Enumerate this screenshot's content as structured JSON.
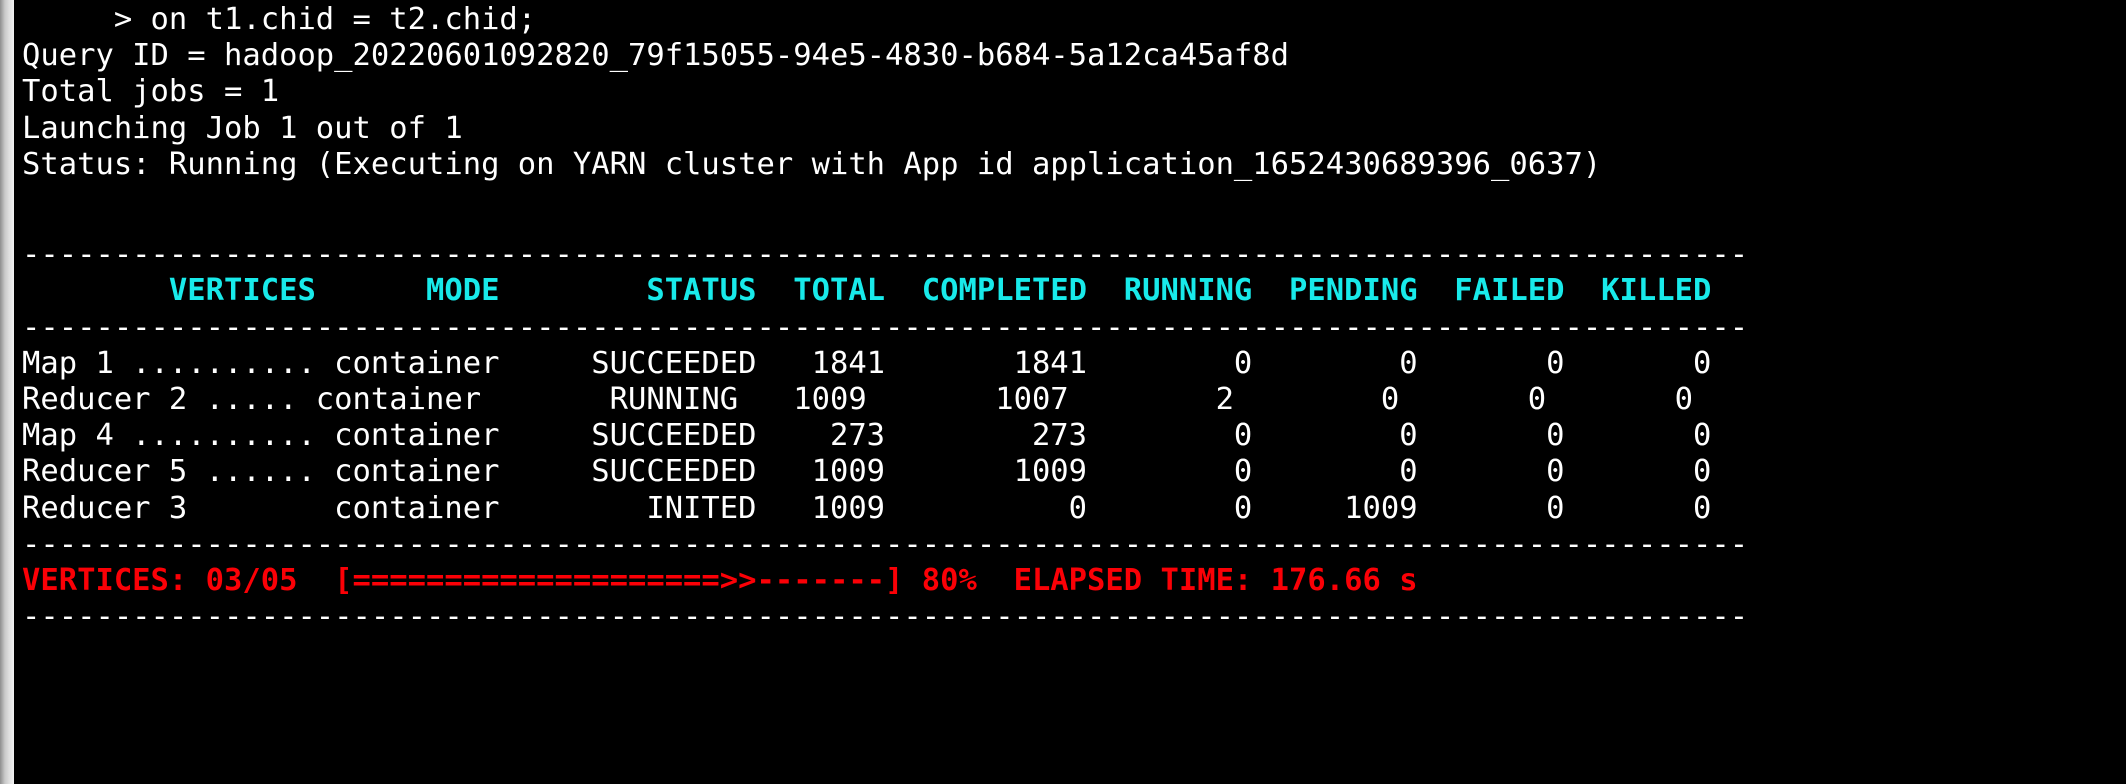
{
  "terminal": {
    "background_color": "#000000",
    "foreground_color": "#ffffff",
    "header_color": "#18eaea",
    "progress_color": "#fb0006",
    "preamble": [
      "     > on t1.chid = t2.chid;",
      "Query ID = hadoop_20220601092820_79f15055-94e5-4830-b684-5a12ca45af8d",
      "Total jobs = 1",
      "Launching Job 1 out of 1",
      "Status: Running (Executing on YARN cluster with App id application_1652430689396_0637)"
    ],
    "separator": "----------------------------------------------------------------------------------------------",
    "table": {
      "header": "        VERTICES      MODE        STATUS  TOTAL  COMPLETED  RUNNING  PENDING  FAILED  KILLED",
      "columns": [
        "VERTICES",
        "MODE",
        "STATUS",
        "TOTAL",
        "COMPLETED",
        "RUNNING",
        "PENDING",
        "FAILED",
        "KILLED"
      ],
      "rows": [
        {
          "line": "Map 1 .......... container     SUCCEEDED   1841       1841        0        0       0       0",
          "vertex": "Map 1 ..........",
          "mode": "container",
          "status": "SUCCEEDED",
          "total": "1841",
          "completed": "1841",
          "running": "0",
          "pending": "0",
          "failed": "0",
          "killed": "0"
        },
        {
          "line": "Reducer 2 ..... container       RUNNING   1009       1007        2        0       0       0",
          "vertex": "Reducer 2 .....",
          "mode": "container",
          "status": "RUNNING",
          "total": "1009",
          "completed": "1007",
          "running": "2",
          "pending": "0",
          "failed": "0",
          "killed": "0"
        },
        {
          "line": "Map 4 .......... container     SUCCEEDED    273        273        0        0       0       0",
          "vertex": "Map 4 ..........",
          "mode": "container",
          "status": "SUCCEEDED",
          "total": "273",
          "completed": "273",
          "running": "0",
          "pending": "0",
          "failed": "0",
          "killed": "0"
        },
        {
          "line": "Reducer 5 ...... container     SUCCEEDED   1009       1009        0        0       0       0",
          "vertex": "Reducer 5 ......",
          "mode": "container",
          "status": "SUCCEEDED",
          "total": "1009",
          "completed": "1009",
          "running": "0",
          "pending": "0",
          "failed": "0",
          "killed": "0"
        },
        {
          "line": "Reducer 3        container        INITED   1009          0        0     1009       0       0",
          "vertex": "Reducer 3",
          "mode": "container",
          "status": "INITED",
          "total": "1009",
          "completed": "0",
          "running": "0",
          "pending": "1009",
          "failed": "0",
          "killed": "0"
        }
      ]
    },
    "status_bar": {
      "line": "VERTICES: 03/05  [====================>>-------] 80%  ELAPSED TIME: 176.66 s",
      "label": "VERTICES:",
      "vertices_count": "03/05",
      "bar": "[====================>>-------]",
      "percent": "80%",
      "elapsed_label": "ELAPSED TIME:",
      "elapsed_value": "176.66 s"
    }
  }
}
